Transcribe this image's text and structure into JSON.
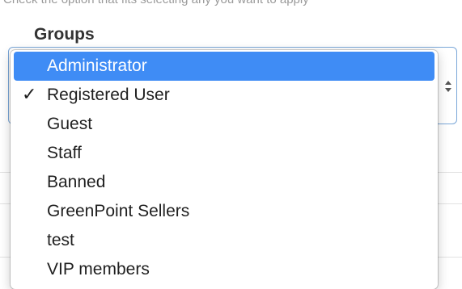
{
  "hint_text": "Check the option that fits selecting any you want to apply",
  "field": {
    "label": "Groups"
  },
  "dropdown": {
    "highlighted_index": 0,
    "checked_index": 1,
    "check_glyph": "✓",
    "options": [
      {
        "label": "Administrator"
      },
      {
        "label": "Registered User"
      },
      {
        "label": "Guest"
      },
      {
        "label": "Staff"
      },
      {
        "label": "Banned"
      },
      {
        "label": "GreenPoint Sellers"
      },
      {
        "label": "test"
      },
      {
        "label": "VIP members"
      }
    ]
  },
  "colors": {
    "highlight": "#3f8cf5",
    "select_border": "#7aa7d8"
  }
}
